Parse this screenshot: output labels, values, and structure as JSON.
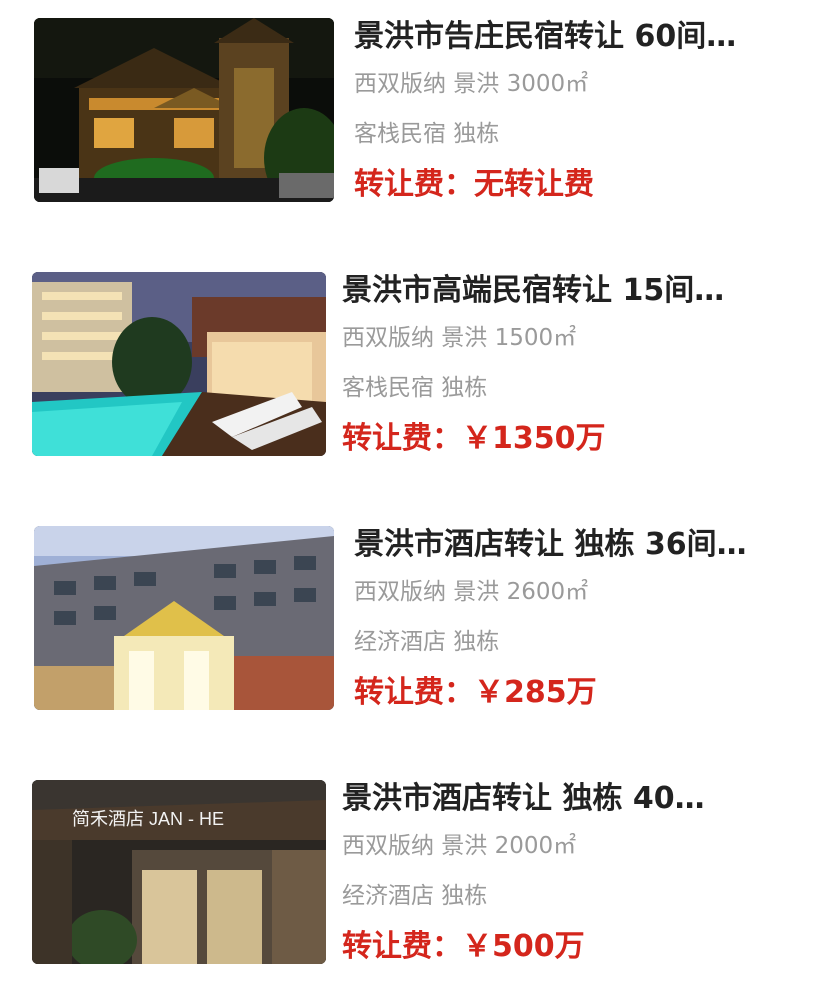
{
  "listings": [
    {
      "title": "景洪市告庄民宿转让 60间…",
      "location": "西双版纳 景洪 3000㎡",
      "category": "客栈民宿 独栋",
      "fee_label": "转让费：",
      "fee_value": "无转让费"
    },
    {
      "title": "景洪市高端民宿转让 15间…",
      "location": "西双版纳 景洪 1500㎡",
      "category": "客栈民宿 独栋",
      "fee_label": "转让费：",
      "fee_value": "￥1350万"
    },
    {
      "title": "景洪市酒店转让 独栋 36间…",
      "location": "西双版纳 景洪 2600㎡",
      "category": "经济酒店 独栋",
      "fee_label": "转让费：",
      "fee_value": "￥285万"
    },
    {
      "title": "景洪市酒店转让 独栋 40…",
      "location": "西双版纳 景洪 2000㎡",
      "category": "经济酒店 独栋",
      "fee_label": "转让费：",
      "fee_value": "￥500万",
      "photo_sign": "简禾酒店 JAN - HE"
    }
  ],
  "colors": {
    "title": "#222222",
    "meta": "#9a9a9a",
    "fee": "#d4261c"
  }
}
